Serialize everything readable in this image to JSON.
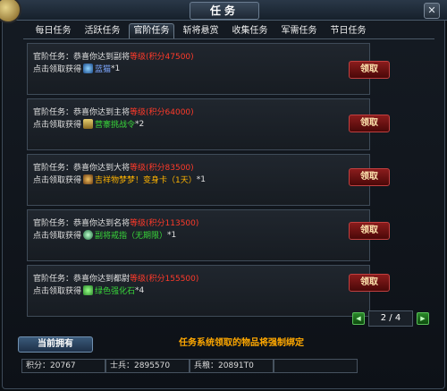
{
  "window": {
    "title": "任务",
    "close_glyph": "✕"
  },
  "tabs": [
    {
      "label": "每日任务",
      "active": false
    },
    {
      "label": "活跃任务",
      "active": false
    },
    {
      "label": "官阶任务",
      "active": true
    },
    {
      "label": "斩将悬赏",
      "active": false
    },
    {
      "label": "收集任务",
      "active": false
    },
    {
      "label": "军需任务",
      "active": false
    },
    {
      "label": "节日任务",
      "active": false
    }
  ],
  "tasks": [
    {
      "prefix": "官阶任务：恭喜你达到副将",
      "grade": "等级(积分47500)",
      "reward_prefix": "点击领取获得",
      "item_icon": "blue-orb-icon",
      "item": "蓝猫",
      "qty": "*1",
      "claim_label": "领取"
    },
    {
      "prefix": "官阶任务：恭喜你达到主将",
      "grade": "等级(积分64000)",
      "reward_prefix": "点击领取获得",
      "item_icon": "flag-icon",
      "item": "营寨挑战令",
      "qty": "*2",
      "claim_label": "领取"
    },
    {
      "prefix": "官阶任务：恭喜你达到大将",
      "grade": "等级(积分83500)",
      "reward_prefix": "点击领取获得",
      "item_icon": "pet-icon",
      "item": "吉祥物梦梦！变身卡（1天）",
      "qty": "*1",
      "claim_label": "领取"
    },
    {
      "prefix": "官阶任务：恭喜你达到名将",
      "grade": "等级(积分113500)",
      "reward_prefix": "点击领取获得",
      "item_icon": "ring-icon",
      "item": "副将戒指（无期限）",
      "qty": "*1",
      "claim_label": "领取"
    },
    {
      "prefix": "官阶任务：恭喜你达到都尉",
      "grade": "等级(积分155500)",
      "reward_prefix": "点击领取获得",
      "item_icon": "gem-icon",
      "item": "绿色强化石",
      "qty": "*4",
      "claim_label": "领取"
    }
  ],
  "pager": {
    "text": "2 / 4",
    "prev_glyph": "◀",
    "next_glyph": "▶"
  },
  "footer": {
    "own_button": "当前拥有",
    "notice": "任务系统领取的物品将强制绑定",
    "stats": [
      {
        "label": "积分：",
        "value": "20767"
      },
      {
        "label": "士兵：",
        "value": "2895570"
      },
      {
        "label": "兵粮：",
        "value": "20891T0"
      },
      {
        "label": "",
        "value": ""
      }
    ]
  },
  "colors": {
    "grade_red": "#ff3a2a",
    "item_green": "#39d83a",
    "notice_orange": "#ffa800",
    "claim_button": "#8a1c1c"
  }
}
